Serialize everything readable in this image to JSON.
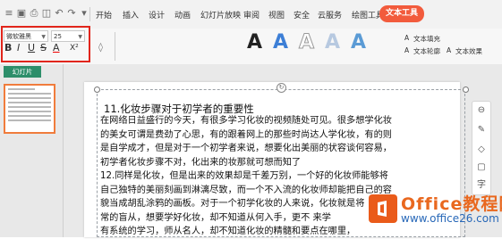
{
  "menubar": {
    "quick_icons": [
      "menu-icon",
      "save-icon",
      "print-icon",
      "preview-icon",
      "undo-icon",
      "redo-icon",
      "more-icon"
    ],
    "items": [
      "开始",
      "插入",
      "设计",
      "动画",
      "幻灯片放映",
      "审阅",
      "视图",
      "安全",
      "云服务",
      "绘图工具"
    ],
    "active_tab": "文本工具"
  },
  "ribbon": {
    "font_name": "微软雅黑",
    "font_size": "25",
    "format_glyphs": {
      "bold": "B",
      "italic": "I",
      "underline": "U",
      "strike": "S",
      "font_color": "A",
      "superscript": "X²",
      "clear": "◊"
    },
    "wordart_letter": "A",
    "wordart_colors": [
      "#222222",
      "#3d7fd6",
      "#e8e8e8",
      "#b7c9e0",
      "#5b9bd5"
    ],
    "text_fill": "文本填充",
    "text_outline": "文本轮廓",
    "text_effect": "文本效果"
  },
  "left_pane": {
    "tab_label": "幻灯片"
  },
  "slide": {
    "title": "11.化妆步骤对于初学者的重要性",
    "lines": [
      "在网络日益盛行的今天，有很多学习化妆的视频随处可见。很多想学化妆",
      "的美女可谓是费劲了心思，有的跟着网上的那些时尚达人学化妆，有的则",
      "是自学成才，但是对于一个初学者来说，想要化出美丽的状容谈何容易，",
      "初学者化妆步骤不对，化出来的妆那就可想而知了",
      "12.同样是化妆，但是出来的效果却是千差万别，一个好的化妆师能够将",
      "自己独特的美丽刻画到淋漓尽致，而一个不入流的化妆师却能把自己的容",
      "貌当成胡乱涂鸦的画板。对于一个初学化妆的人来说，化妆就是将",
      "常的盲从，想要学好化妆，却不知道从何入手，更不              来学",
      "有系统的学习，师从名人，却不知道化妆的精髓和要点在哪里，"
    ]
  },
  "watermark": {
    "title": "Office教程网",
    "url": "www.office26.com"
  }
}
